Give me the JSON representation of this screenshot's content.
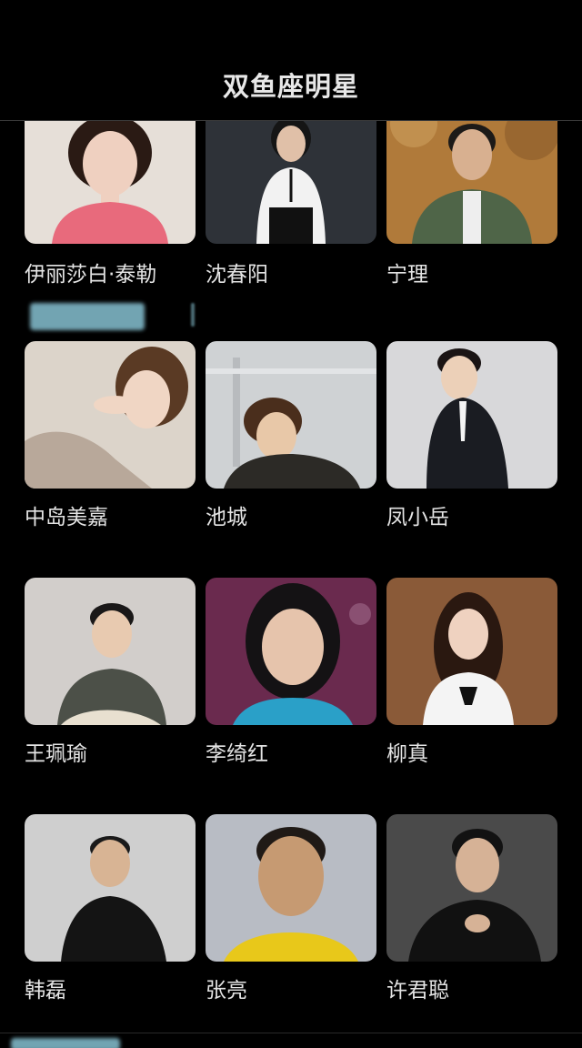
{
  "header": {
    "title": "双鱼座明星"
  },
  "stars": [
    {
      "name": "伊丽莎白·泰勒",
      "bg": "#e6dfd8",
      "skin": "#efd0c0",
      "hair": "#2a1a14",
      "top": "#e86a7c"
    },
    {
      "name": "沈春阳",
      "bg": "#2e3238",
      "skin": "#e0c0a8",
      "hair": "#151515",
      "top": "#f2f2f2"
    },
    {
      "name": "宁理",
      "bg": "#b07a3a",
      "skin": "#d8b090",
      "hair": "#1c1a18",
      "top": "#4f6548"
    },
    {
      "name": "中岛美嘉",
      "bg": "#dcd4ca",
      "skin": "#f0d6c4",
      "hair": "#5a3a24",
      "top": "#b8a89a"
    },
    {
      "name": "池城",
      "bg": "#cfd2d4",
      "skin": "#e8c8a8",
      "hair": "#4a2e1c",
      "top": "#2c2a26"
    },
    {
      "name": "凤小岳",
      "bg": "#d8d8da",
      "skin": "#ecd0b8",
      "hair": "#1a1414",
      "top": "#1a1c22"
    },
    {
      "name": "王珮瑜",
      "bg": "#d2cecb",
      "skin": "#e8cab0",
      "hair": "#1a1818",
      "top": "#4c5048"
    },
    {
      "name": "李绮红",
      "bg": "#6a2a4e",
      "skin": "#e6c4ac",
      "hair": "#141214",
      "top": "#2aa0c8"
    },
    {
      "name": "柳真",
      "bg": "#8a5a38",
      "skin": "#efd2c0",
      "hair": "#2a1810",
      "top": "#f4f4f4"
    },
    {
      "name": "韩磊",
      "bg": "#cfcfcf",
      "skin": "#d8b494",
      "hair": "#1a1a1a",
      "top": "#141414"
    },
    {
      "name": "张亮",
      "bg": "#b8bcc4",
      "skin": "#c69a72",
      "hair": "#201a16",
      "top": "#e8c81a"
    },
    {
      "name": "许君聪",
      "bg": "#4a4a4a",
      "skin": "#d6b296",
      "hair": "#121212",
      "top": "#111111"
    }
  ]
}
